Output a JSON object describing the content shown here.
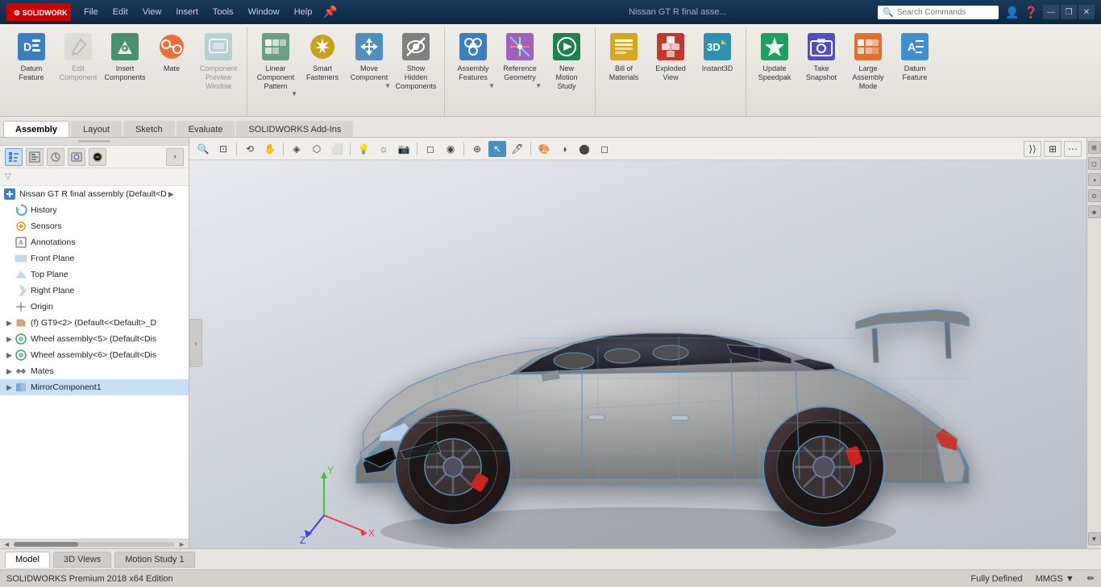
{
  "titlebar": {
    "logo": "SOLIDWORKS",
    "menus": [
      "File",
      "Edit",
      "View",
      "Insert",
      "Tools",
      "Window",
      "Help"
    ],
    "title": "Nissan GT R final asse...",
    "search_placeholder": "Search Commands",
    "win_btns": [
      "—",
      "❐",
      "✕"
    ]
  },
  "toolbar": {
    "sections": [
      {
        "tools": [
          {
            "id": "datum-feature",
            "label": "Datum\nFeature",
            "icon": "datum"
          },
          {
            "id": "edit-component",
            "label": "Edit\nComponent",
            "icon": "edit-comp",
            "disabled": true
          },
          {
            "id": "insert-components",
            "label": "Insert\nComponents",
            "icon": "insert-comp"
          },
          {
            "id": "mate",
            "label": "Mate",
            "icon": "mate"
          },
          {
            "id": "component-preview",
            "label": "Component\nPreview\nWindow",
            "icon": "comp-prev",
            "disabled": true
          }
        ]
      },
      {
        "tools": [
          {
            "id": "linear-component-pattern",
            "label": "Linear Component\nPattern",
            "icon": "linear-pat",
            "has_arrow": true
          },
          {
            "id": "smart-fasteners",
            "label": "Smart\nFasteners",
            "icon": "smart-fast"
          },
          {
            "id": "move-component",
            "label": "Move\nComponent",
            "icon": "move-comp",
            "has_arrow": true
          },
          {
            "id": "show-hidden-components",
            "label": "Show\nHidden\nComponents",
            "icon": "show-hidden"
          }
        ]
      },
      {
        "tools": [
          {
            "id": "assembly-features",
            "label": "Assembly\nFeatures",
            "icon": "asm-feat",
            "has_arrow": true
          },
          {
            "id": "reference-geometry",
            "label": "Reference\nGeometry",
            "icon": "ref-geom",
            "has_arrow": true
          },
          {
            "id": "new-motion-study",
            "label": "New\nMotion\nStudy",
            "icon": "motion"
          }
        ]
      },
      {
        "tools": [
          {
            "id": "bill-of-materials",
            "label": "Bill of\nMaterials",
            "icon": "bom"
          },
          {
            "id": "exploded-view",
            "label": "Exploded\nView",
            "icon": "exploded"
          },
          {
            "id": "instant3d",
            "label": "Instant3D",
            "icon": "instant3d"
          }
        ]
      },
      {
        "tools": [
          {
            "id": "update-speedpak",
            "label": "Update\nSpeedpak",
            "icon": "speedpak"
          },
          {
            "id": "take-snapshot",
            "label": "Take\nSnapshot",
            "icon": "snapshot"
          },
          {
            "id": "large-assembly-mode",
            "label": "Large\nAssembly\nMode",
            "icon": "large-asm"
          },
          {
            "id": "datum-feature2",
            "label": "Datum\nFeature",
            "icon": "datum-feat"
          }
        ]
      }
    ]
  },
  "tabs": [
    "Assembly",
    "Layout",
    "Sketch",
    "Evaluate",
    "SOLIDWORKS Add-Ins"
  ],
  "active_tab": "Assembly",
  "left_panel": {
    "tree_items": [
      {
        "id": "root",
        "label": "Nissan GT R final assembly  (Default<D",
        "icon": "assembly",
        "indent": 0,
        "arrow": "▶"
      },
      {
        "id": "history",
        "label": "History",
        "icon": "history",
        "indent": 1,
        "arrow": ""
      },
      {
        "id": "sensors",
        "label": "Sensors",
        "icon": "sensor",
        "indent": 1,
        "arrow": ""
      },
      {
        "id": "annotations",
        "label": "Annotations",
        "icon": "annotation",
        "indent": 1,
        "arrow": ""
      },
      {
        "id": "front-plane",
        "label": "Front Plane",
        "icon": "plane",
        "indent": 1,
        "arrow": ""
      },
      {
        "id": "top-plane",
        "label": "Top Plane",
        "icon": "plane",
        "indent": 1,
        "arrow": ""
      },
      {
        "id": "right-plane",
        "label": "Right Plane",
        "icon": "plane",
        "indent": 1,
        "arrow": ""
      },
      {
        "id": "origin",
        "label": "Origin",
        "icon": "origin",
        "indent": 1,
        "arrow": ""
      },
      {
        "id": "gt9-2",
        "label": "(f) GT9<2> (Default<<Default>_D",
        "icon": "part",
        "indent": 1,
        "arrow": "▶"
      },
      {
        "id": "wheel-5",
        "label": "Wheel assembly<5> (Default<Dis",
        "icon": "wheel",
        "indent": 1,
        "arrow": "▶"
      },
      {
        "id": "wheel-6",
        "label": "Wheel assembly<6> (Default<Dis",
        "icon": "wheel",
        "indent": 1,
        "arrow": "▶"
      },
      {
        "id": "mates",
        "label": "Mates",
        "icon": "mates",
        "indent": 1,
        "arrow": "▶"
      },
      {
        "id": "mirror-comp",
        "label": "MirrorComponent1",
        "icon": "mirror",
        "indent": 1,
        "arrow": "▶",
        "selected": true
      }
    ]
  },
  "viewport": {
    "vp_tools": [
      "🔍",
      "🔎",
      "⟲",
      "⬜",
      "◈",
      "⬡",
      "✂",
      "◉",
      "⊕",
      "⊠",
      "🎨",
      "◑",
      "⬤",
      "◻"
    ],
    "right_tools": [
      "◻",
      "◻",
      "◻",
      "◻",
      "◻",
      "◻"
    ],
    "coord_x": "X",
    "coord_y": "Y",
    "coord_z": "Z"
  },
  "bottom_tabs": [
    "Model",
    "3D Views",
    "Motion Study 1"
  ],
  "active_bottom_tab": "Model",
  "statusbar": {
    "left": "SOLIDWORKS Premium 2018 x64 Edition",
    "status": "Fully Defined",
    "units": "MMGS",
    "icon": "▼"
  }
}
